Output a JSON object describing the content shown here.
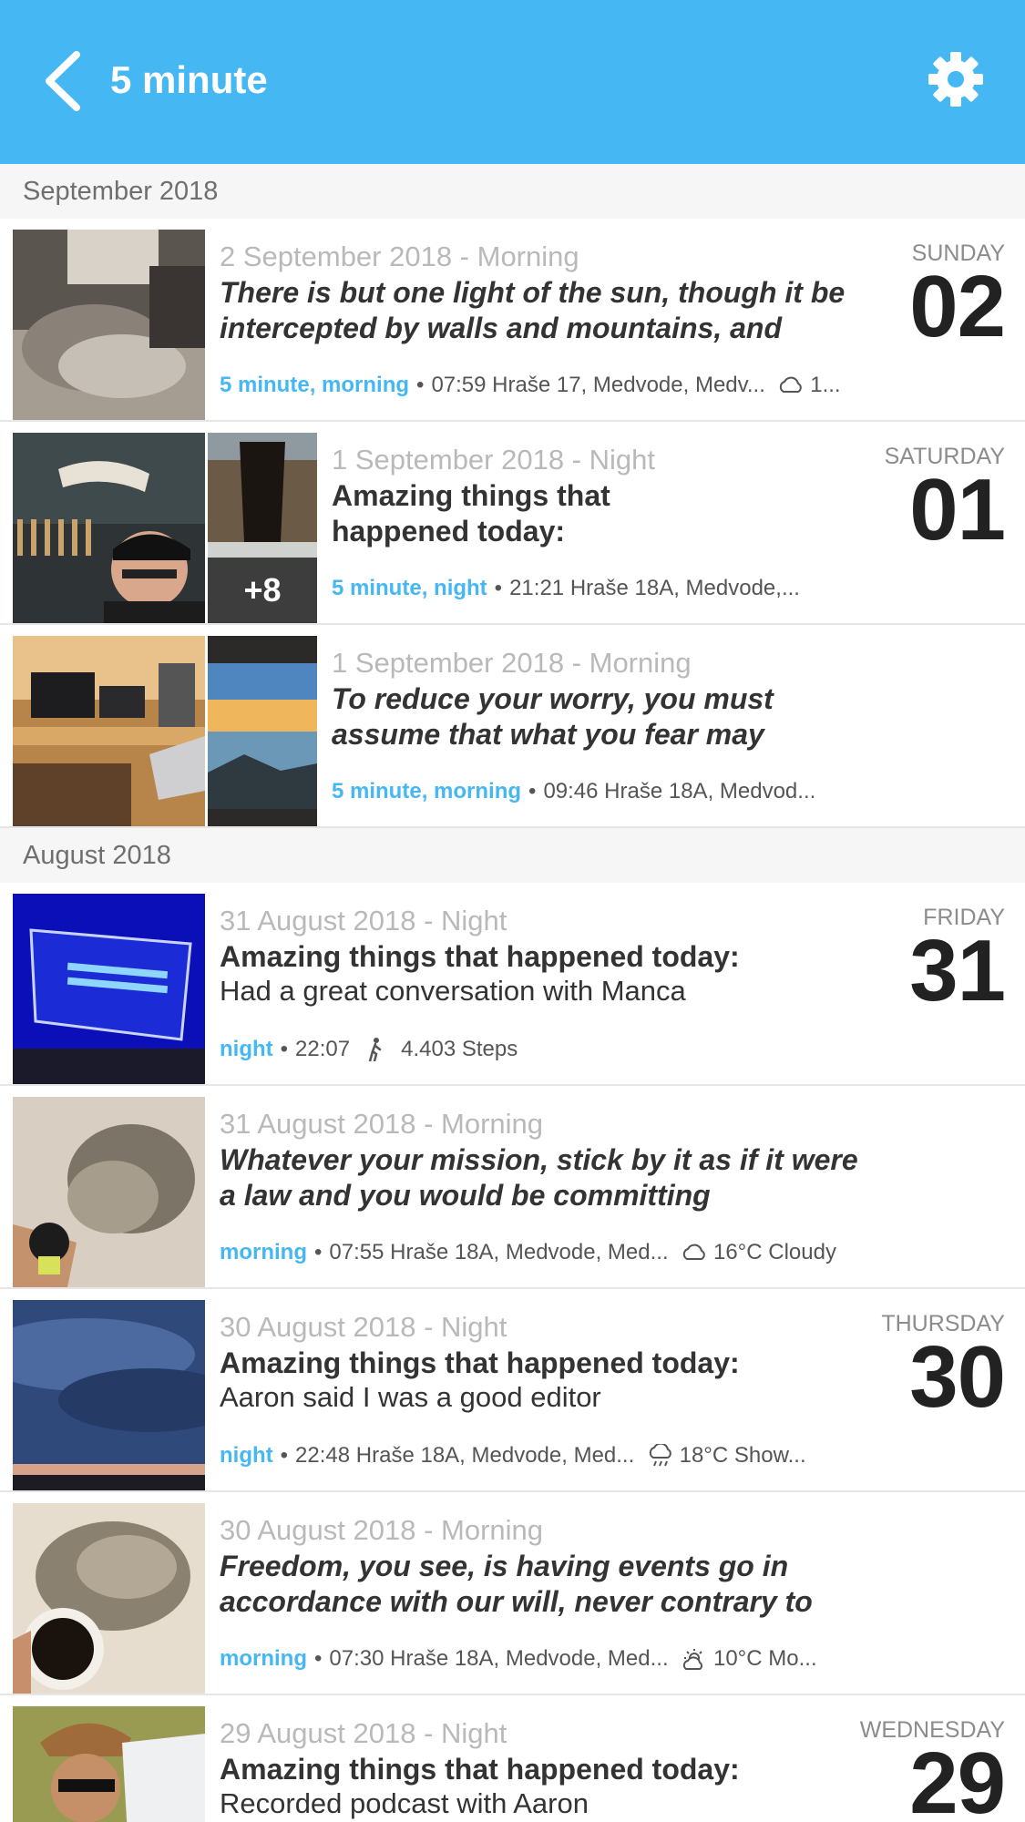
{
  "header": {
    "title": "5 minute"
  },
  "sections": [
    {
      "label": "September 2018",
      "entries": [
        {
          "date": "2 September 2018 - Morning",
          "title": "There is but one light of the sun, though it be intercepted by walls and mountains, and",
          "weekday": "SUNDAY",
          "day": "02",
          "tags": [
            "5 minute",
            "morning"
          ],
          "time": "07:59",
          "location": "Hraše 17, Medvode, Medv...",
          "weather_icon": "cloud-icon",
          "weather": "1..."
        },
        {
          "date": "1 September 2018 - Night",
          "title": "Amazing things that happened today:",
          "weekday": "SATURDAY",
          "day": "01",
          "more_photos": "+8",
          "tags": [
            "5 minute",
            "night"
          ],
          "time": "21:21",
          "location": "Hraše 18A, Medvode,..."
        },
        {
          "date": "1 September 2018 - Morning",
          "title": "To reduce your worry, you must assume that what you fear may",
          "tags": [
            "5 minute",
            "morning"
          ],
          "time": "09:46",
          "location": "Hraše 18A, Medvod..."
        }
      ]
    },
    {
      "label": "August 2018",
      "entries": [
        {
          "date": "31 August 2018 - Night",
          "title": "Amazing things that happened today:",
          "body": "Had a great conversation with Manca",
          "weekday": "FRIDAY",
          "day": "31",
          "tags": [
            "night"
          ],
          "time": "22:07",
          "steps_icon": "walking-icon",
          "steps": "4.403 Steps"
        },
        {
          "date": "31 August 2018 - Morning",
          "title": "Whatever your mission, stick by it as if it were a law and you would be committing",
          "tags": [
            "morning"
          ],
          "time": "07:55",
          "location": "Hraše 18A, Medvode, Med...",
          "weather_icon": "cloud-icon",
          "weather": "16°C Cloudy"
        },
        {
          "date": "30 August 2018 - Night",
          "title": "Amazing things that happened today:",
          "body": "Aaron said I was a good editor",
          "weekday": "THURSDAY",
          "day": "30",
          "tags": [
            "night"
          ],
          "time": "22:48",
          "location": "Hraše 18A, Medvode, Med...",
          "weather_icon": "rain-cloud-icon",
          "weather": "18°C Show..."
        },
        {
          "date": "30 August 2018 - Morning",
          "title": "Freedom, you see, is having events go in accordance with our will, never contrary to",
          "tags": [
            "morning"
          ],
          "time": "07:30",
          "location": "Hraše 18A, Medvode, Med...",
          "weather_icon": "partly-sunny-icon",
          "weather": "10°C Mo..."
        },
        {
          "date": "29 August 2018 - Night",
          "title": "Amazing things that happened today:",
          "body": "Recorded podcast with Aaron",
          "weekday": "WEDNESDAY",
          "day": "29"
        }
      ]
    }
  ],
  "colors": {
    "header": "#45b8f4",
    "tag": "#45b8f4",
    "date": "#b9b9b9",
    "section_bg": "#f6f6f6"
  }
}
